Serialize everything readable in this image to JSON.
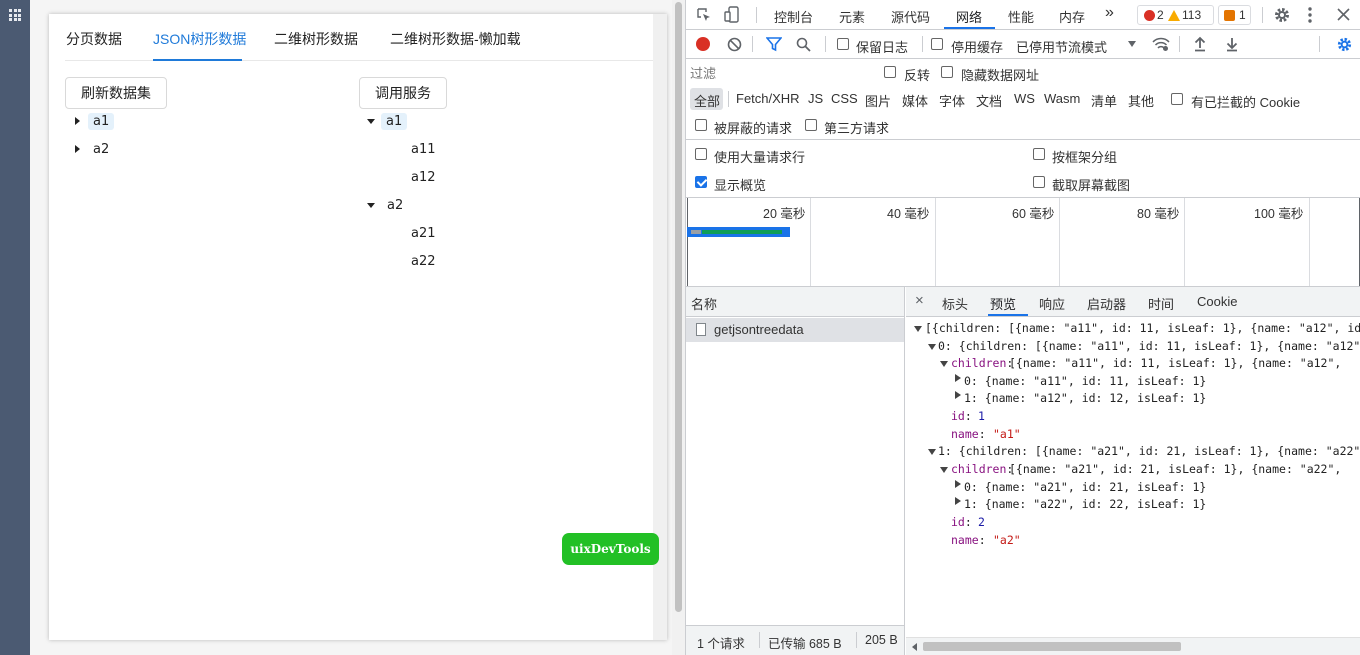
{
  "app": {
    "tabs": [
      "分页数据",
      "JSON树形数据",
      "二维树形数据",
      "二维树形数据-懒加载"
    ],
    "active_tab": "JSON树形数据",
    "buttons": {
      "refresh": "刷新数据集",
      "call_service": "调用服务",
      "uix": "uixDevTools"
    },
    "left_tree": [
      {
        "label": "a1",
        "selected": true,
        "expanded": false
      },
      {
        "label": "a2",
        "expanded": false
      }
    ],
    "right_tree": [
      {
        "label": "a1",
        "selected": true,
        "expanded": true,
        "children": [
          "a11",
          "a12"
        ]
      },
      {
        "label": "a2",
        "expanded": true,
        "children": [
          "a21",
          "a22"
        ]
      }
    ]
  },
  "devtools": {
    "main_tabs": [
      "控制台",
      "元素",
      "源代码",
      "网络",
      "性能",
      "内存"
    ],
    "active_main_tab": "网络",
    "more_tabs": "»",
    "errors": "2",
    "warnings": "113",
    "issues": "1",
    "toolbar": {
      "preserve_log": "保留日志",
      "disable_cache": "停用缓存",
      "throttle": "已停用节流模式"
    },
    "filter": {
      "placeholder": "过滤",
      "invert": "反转",
      "hide_data_urls": "隐藏数据网址"
    },
    "types": [
      "全部",
      "Fetch/XHR",
      "JS",
      "CSS",
      "图片",
      "媒体",
      "字体",
      "文档",
      "WS",
      "Wasm",
      "清单",
      "其他"
    ],
    "blocked_cookies": "有已拦截的 Cookie",
    "blocked_requests": "被屏蔽的请求",
    "third_party": "第三方请求",
    "options": {
      "large_rows": "使用大量请求行",
      "group_by_frame": "按框架分组",
      "show_overview": "显示概览",
      "screenshots": "截取屏幕截图"
    },
    "timeline_ticks": [
      "20 毫秒",
      "40 毫秒",
      "60 毫秒",
      "80 毫秒",
      "100 毫秒"
    ],
    "name_header": "名称",
    "requests": [
      "getjsontreedata"
    ],
    "detail_tabs": [
      "标头",
      "预览",
      "响应",
      "启动器",
      "时间",
      "Cookie"
    ],
    "active_detail_tab": "预览",
    "close_symbol": "×",
    "status": {
      "requests": "1 个请求",
      "transferred": "已传输 685 B",
      "resources": "205 B"
    },
    "preview": {
      "root": "[{children: [{name: \"a11\", id: 11, isLeaf: 1}, {name: \"a12\", id",
      "i0": "0: {children: [{name: \"a11\", id: 11, isLeaf: 1}, {name: \"a12\"",
      "i0_children": "[{name: \"a11\", id: 11, isLeaf: 1}, {name: \"a12\",",
      "i0_c0": "0: {name: \"a11\", id: 11, isLeaf: 1}",
      "i0_c1": "1: {name: \"a12\", id: 12, isLeaf: 1}",
      "i0_id": "1",
      "i0_name": "\"a1\"",
      "i1": "1: {children: [{name: \"a21\", id: 21, isLeaf: 1}, {name: \"a22\"",
      "i1_children": "[{name: \"a21\", id: 21, isLeaf: 1}, {name: \"a22\",",
      "i1_c0": "0: {name: \"a21\", id: 21, isLeaf: 1}",
      "i1_c1": "1: {name: \"a22\", id: 22, isLeaf: 1}",
      "i1_id": "2",
      "i1_name": "\"a2\"",
      "k_children": "children",
      "k_id": "id",
      "k_name": "name"
    }
  }
}
